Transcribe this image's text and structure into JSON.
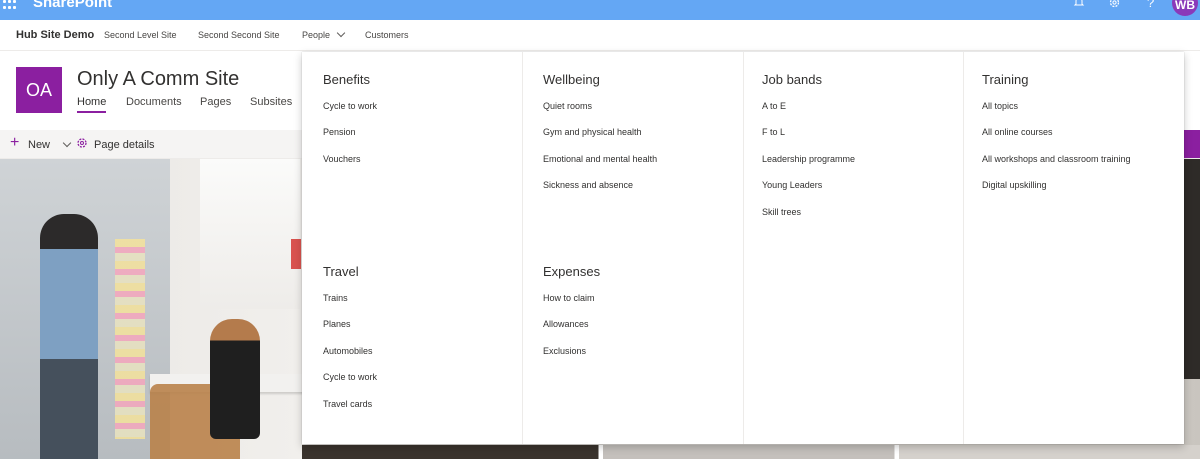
{
  "suite_bar": {
    "brand": "SharePoint",
    "icons": [
      "waffle-icon",
      "bell-icon",
      "gear-icon",
      "help-icon"
    ],
    "avatar_initials": "WB"
  },
  "hub_nav": {
    "title": "Hub Site Demo",
    "links": [
      "Second Level Site",
      "Second Second Site",
      "People",
      "Customers"
    ]
  },
  "site": {
    "logo_text": "OA",
    "title": "Only A Comm Site",
    "nav": [
      "Home",
      "Documents",
      "Pages",
      "Subsites"
    ]
  },
  "command_bar": {
    "new_label": "New",
    "page_details_label": "Page details"
  },
  "mega_menu": {
    "groups": [
      {
        "heading": "Benefits",
        "links": [
          "Cycle to work",
          "Pension",
          "Vouchers"
        ]
      },
      {
        "heading": "Wellbeing",
        "links": [
          "Quiet rooms",
          "Gym and physical health",
          "Emotional and mental health",
          "Sickness and absence"
        ]
      },
      {
        "heading": "Job bands",
        "links": [
          "A to E",
          "F to L",
          "Leadership programme",
          "Young Leaders",
          "Skill trees"
        ]
      },
      {
        "heading": "Training",
        "links": [
          "All topics",
          "All online courses",
          "All workshops and classroom training",
          "Digital upskilling"
        ]
      },
      {
        "heading": "Travel",
        "links": [
          "Trains",
          "Planes",
          "Automobiles",
          "Cycle to work",
          "Travel cards"
        ]
      },
      {
        "heading": "Expenses",
        "links": [
          "How to claim",
          "Allowances",
          "Exclusions"
        ]
      }
    ]
  },
  "colors": {
    "suite_bar": "#64a7f4",
    "accent": "#8b1fa0"
  }
}
